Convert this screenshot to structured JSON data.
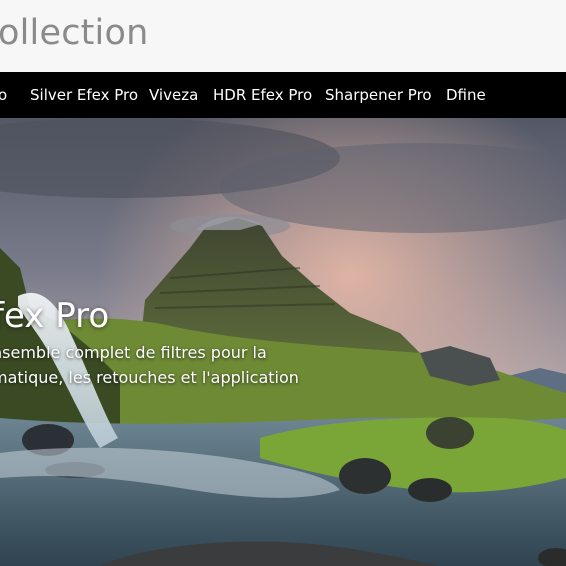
{
  "header": {
    "title": "ollection"
  },
  "nav": {
    "items": [
      {
        "label": "o",
        "name": "nav-item-partial"
      },
      {
        "label": "Silver Efex Pro",
        "name": "nav-item-silver-efex-pro"
      },
      {
        "label": "Viveza",
        "name": "nav-item-viveza"
      },
      {
        "label": "HDR Efex Pro",
        "name": "nav-item-hdr-efex-pro"
      },
      {
        "label": "Sharpener Pro",
        "name": "nav-item-sharpener-pro"
      },
      {
        "label": "Dfine",
        "name": "nav-item-dfine"
      }
    ]
  },
  "hero": {
    "title": "fex Pro",
    "description_line1": "nsemble complet de filtres pour la",
    "description_line2": "matique, les retouches et l'application"
  },
  "colors": {
    "nav_background": "#000000",
    "header_background": "#f7f7f7",
    "title_text": "#8a8a8a"
  }
}
